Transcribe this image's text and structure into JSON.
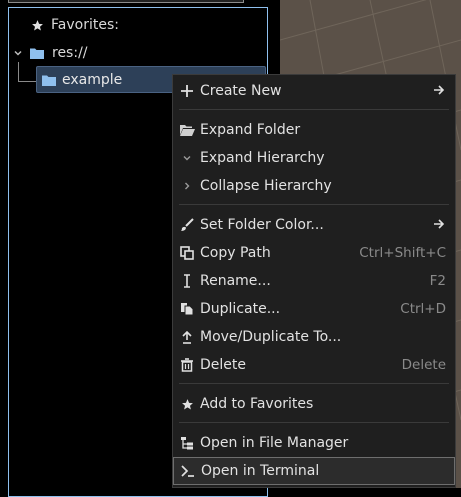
{
  "tree": {
    "favorites_label": "Favorites:",
    "root_label": "res://",
    "child_label": "example"
  },
  "menu": {
    "create_new": "Create New",
    "expand_folder": "Expand Folder",
    "expand_hierarchy": "Expand Hierarchy",
    "collapse_hierarchy": "Collapse Hierarchy",
    "set_folder_color": "Set Folder Color...",
    "copy_path": "Copy Path",
    "copy_path_shortcut": "Ctrl+Shift+C",
    "rename": "Rename...",
    "rename_shortcut": "F2",
    "duplicate": "Duplicate...",
    "duplicate_shortcut": "Ctrl+D",
    "move_duplicate": "Move/Duplicate To...",
    "delete": "Delete",
    "delete_shortcut": "Delete",
    "add_favorites": "Add to Favorites",
    "open_file_manager": "Open in File Manager",
    "open_terminal": "Open in Terminal"
  },
  "colors": {
    "folder_icon": "#8fc0ee",
    "selection": "#2d4058",
    "menu_bg": "#1f1f1f",
    "viewport_bg": "#5b5148"
  }
}
